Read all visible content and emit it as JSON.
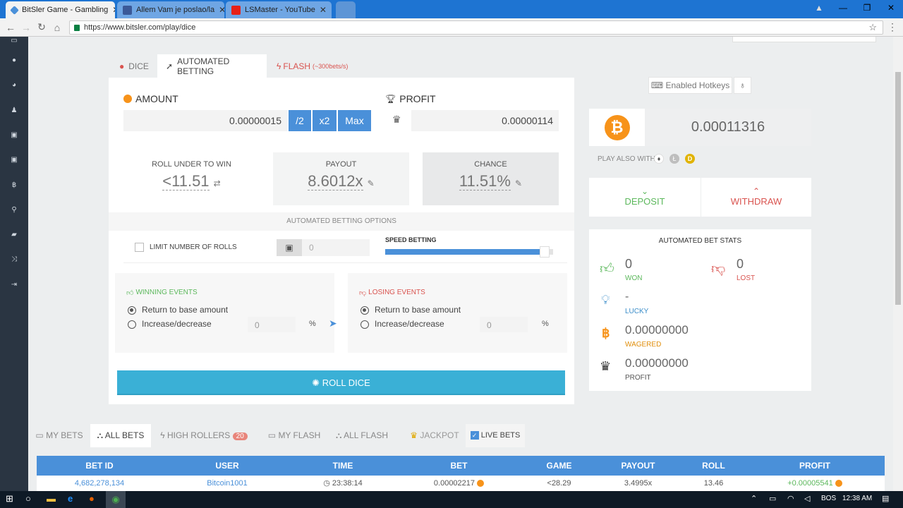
{
  "browser": {
    "tabs": [
      {
        "title": "BitSler Game - Gambling",
        "active": true
      },
      {
        "title": "Allem Vam je poslao/la",
        "active": false
      },
      {
        "title": "LSMaster - YouTube",
        "active": false
      }
    ],
    "url": "https://www.bitsler.com/play/dice"
  },
  "game_tabs": {
    "dice": "DICE",
    "automated": "AUTOMATED BETTING",
    "flash": "FLASH",
    "flash_sub": "(~300bets/s)"
  },
  "amount": {
    "label": "AMOUNT",
    "value": "0.00000015",
    "half": "/2",
    "double": "x2",
    "max": "Max"
  },
  "profit": {
    "label": "PROFIT",
    "value": "0.00000114"
  },
  "roll": {
    "label": "ROLL UNDER TO WIN",
    "value": "<11.51",
    "swap_icon": "swap-icon"
  },
  "payout": {
    "label": "PAYOUT",
    "value": "8.6012x"
  },
  "chance": {
    "label": "CHANCE",
    "value": "11.51%"
  },
  "options": {
    "title": "AUTOMATED BETTING OPTIONS",
    "limit_label": "LIMIT NUMBER OF ROLLS",
    "limit_value": "0",
    "speed_label": "SPEED BETTING",
    "speed_level": 0.95
  },
  "winning": {
    "title": "WINNING EVENTS",
    "opt1": "Return to base amount",
    "opt2": "Increase/decrease",
    "value": "0",
    "unit": "%"
  },
  "losing": {
    "title": "LOSING EVENTS",
    "opt1": "Return to base amount",
    "opt2": "Increase/decrease",
    "value": "0",
    "unit": "%"
  },
  "roll_button": "ROLL DICE",
  "hotkeys": "Enabled Hotkeys",
  "balance": "0.00011316",
  "play_also": "PLAY ALSO WITH:",
  "deposit": "DEPOSIT",
  "withdraw": "WITHDRAW",
  "stats": {
    "title": "AUTOMATED BET STATS",
    "won": "0",
    "won_label": "WON",
    "lost": "0",
    "lost_label": "LOST",
    "lucky": "-",
    "lucky_label": "LUCKY",
    "wagered": "0.00000000",
    "wagered_label": "WAGERED",
    "profit": "0.00000000",
    "profit_label": "PROFIT"
  },
  "bet_tabs": {
    "my_bets": "MY BETS",
    "all_bets": "ALL BETS",
    "high_rollers": "HIGH ROLLERS",
    "high_rollers_count": "20",
    "my_flash": "MY FLASH",
    "all_flash": "ALL FLASH",
    "jackpot": "JACKPOT",
    "live_bets": "LIVE BETS"
  },
  "table": {
    "headers": [
      "BET ID",
      "USER",
      "TIME",
      "BET",
      "GAME",
      "PAYOUT",
      "ROLL",
      "PROFIT"
    ],
    "rows": [
      [
        "4,682,278,134",
        "Bitcoin1001",
        "23:38:14",
        "0.00002217",
        "<28.29",
        "3.4995x",
        "13.46",
        "+0.00005541"
      ]
    ]
  },
  "colors": {
    "accent": "#4a90d9",
    "roll_button": "#3ab0d6",
    "header_blue": "#4a90d9",
    "won_green": "#5cb85c",
    "lost_red": "#d9534f",
    "bitcoin": "#f7931a"
  },
  "taskbar": {
    "lang": "BOS",
    "time": "12:38 AM"
  }
}
